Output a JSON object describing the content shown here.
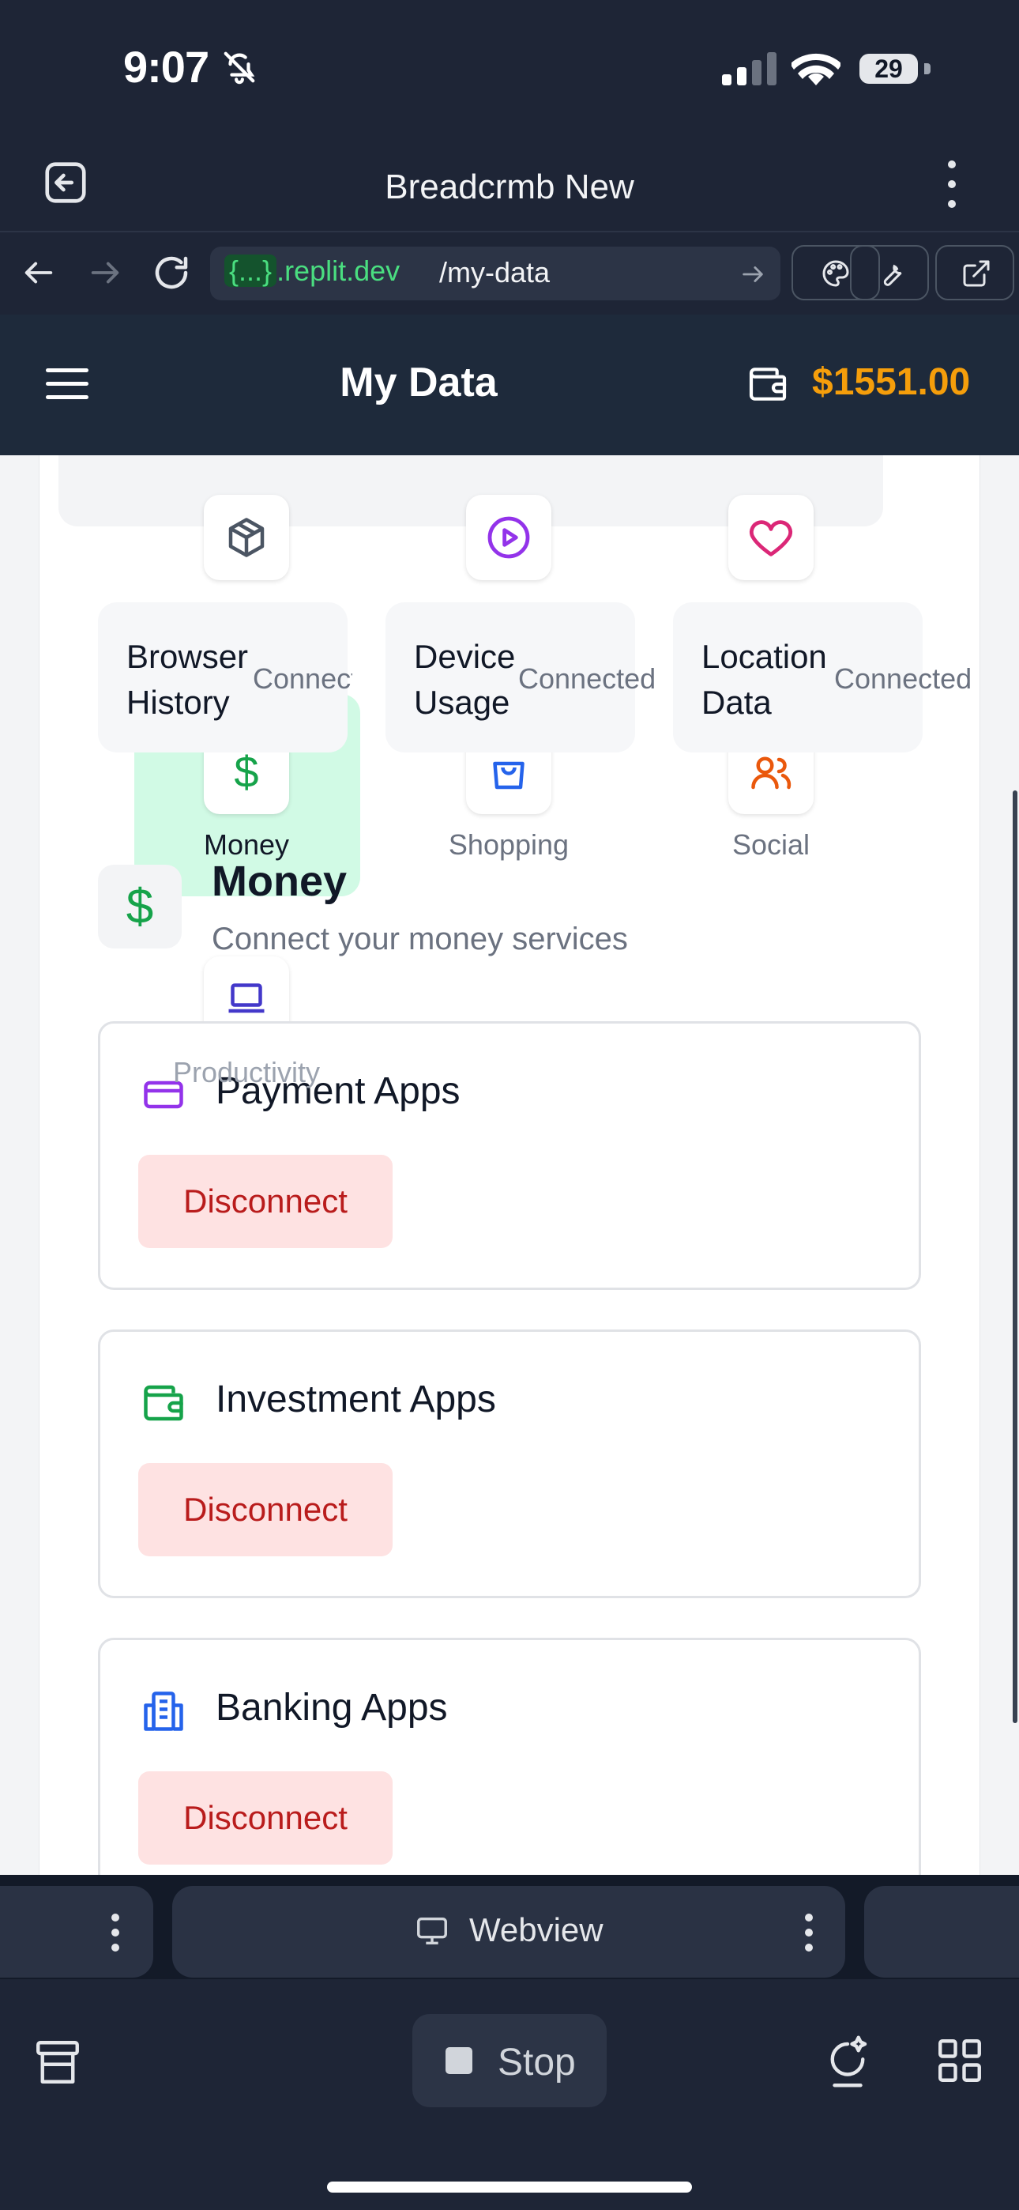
{
  "status_bar": {
    "time": "9:07",
    "battery_level": "29"
  },
  "browser": {
    "title": "Breadcrmb New",
    "url_bracket": "{...}",
    "url_domain": ".replit.dev",
    "url_path": "/my-data"
  },
  "header": {
    "title": "My Data",
    "wallet_amount": "$1551.00",
    "accent_color": "#f59e0b"
  },
  "categories": [
    {
      "label": "Money",
      "icon": "dollar-icon",
      "active": true
    },
    {
      "label": "Shopping",
      "icon": "shopping-bag-icon",
      "active": false
    },
    {
      "label": "Social",
      "icon": "users-icon",
      "active": false
    },
    {
      "label": "Productivity",
      "icon": "laptop-icon",
      "active": false
    }
  ],
  "top_icons": [
    "package-icon",
    "play-circle-icon",
    "heart-icon"
  ],
  "data_sources": [
    {
      "name_line1": "Browser",
      "name_line2": "History",
      "status": "Connected"
    },
    {
      "name_line1": "Device",
      "name_line2": "Usage",
      "status": "Connected"
    },
    {
      "name_line1": "Location",
      "name_line2": "Data",
      "status": "Connected"
    }
  ],
  "section": {
    "title": "Money",
    "subtitle": "Connect your money services"
  },
  "app_cards": [
    {
      "title": "Payment Apps",
      "icon": "credit-card-icon",
      "button": "Disconnect"
    },
    {
      "title": "Investment Apps",
      "icon": "wallet-icon",
      "button": "Disconnect"
    },
    {
      "title": "Banking Apps",
      "icon": "building-icon",
      "button": "Disconnect"
    }
  ],
  "bottom": {
    "tab_label": "Webview",
    "stop_label": "Stop"
  }
}
